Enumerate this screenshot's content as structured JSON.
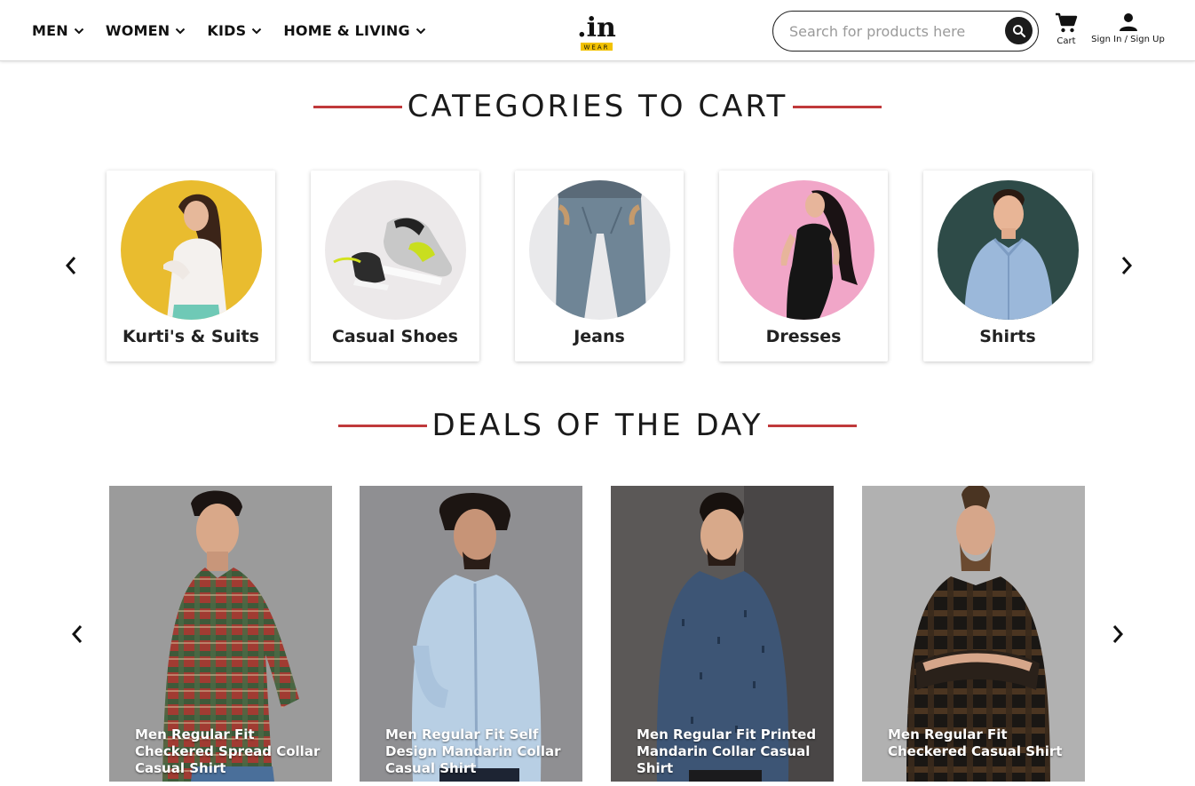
{
  "header": {
    "nav": [
      {
        "label": "MEN"
      },
      {
        "label": "WOMEN"
      },
      {
        "label": "KIDS"
      },
      {
        "label": "HOME & LIVING"
      }
    ],
    "logo": {
      "main": ".in",
      "sub": "WEAR"
    },
    "search": {
      "placeholder": "Search for products here"
    },
    "cart_label": "Cart",
    "signin_label": "Sign In / Sign Up"
  },
  "categories": {
    "title": "CATEGORIES TO CART",
    "items": [
      {
        "label": "Kurti's & Suits",
        "bg": "#e9bc2f"
      },
      {
        "label": "Casual Shoes",
        "bg": "#ece9ea"
      },
      {
        "label": "Jeans",
        "bg": "#e9e9eb"
      },
      {
        "label": "Dresses",
        "bg": "#f1a6c8"
      },
      {
        "label": "Shirts",
        "bg": "#2e4b48"
      }
    ]
  },
  "deals": {
    "title": "DEALS OF THE DAY",
    "items": [
      {
        "name": "Men Regular Fit Checkered Spread Collar Casual Shirt",
        "bg": "#9b9b9b"
      },
      {
        "name": "Men Regular Fit Self Design Mandarin Collar Casual Shirt",
        "bg": "#8f8f92"
      },
      {
        "name": "Men Regular Fit Printed Mandarin Collar Casual Shirt",
        "bg": "#5b5857"
      },
      {
        "name": "Men Regular Fit Checkered Casual Shirt",
        "bg": "#b1b1b1"
      }
    ]
  },
  "colors": {
    "accent_line": "#c0393b",
    "logo_yellow": "#f2c200"
  }
}
